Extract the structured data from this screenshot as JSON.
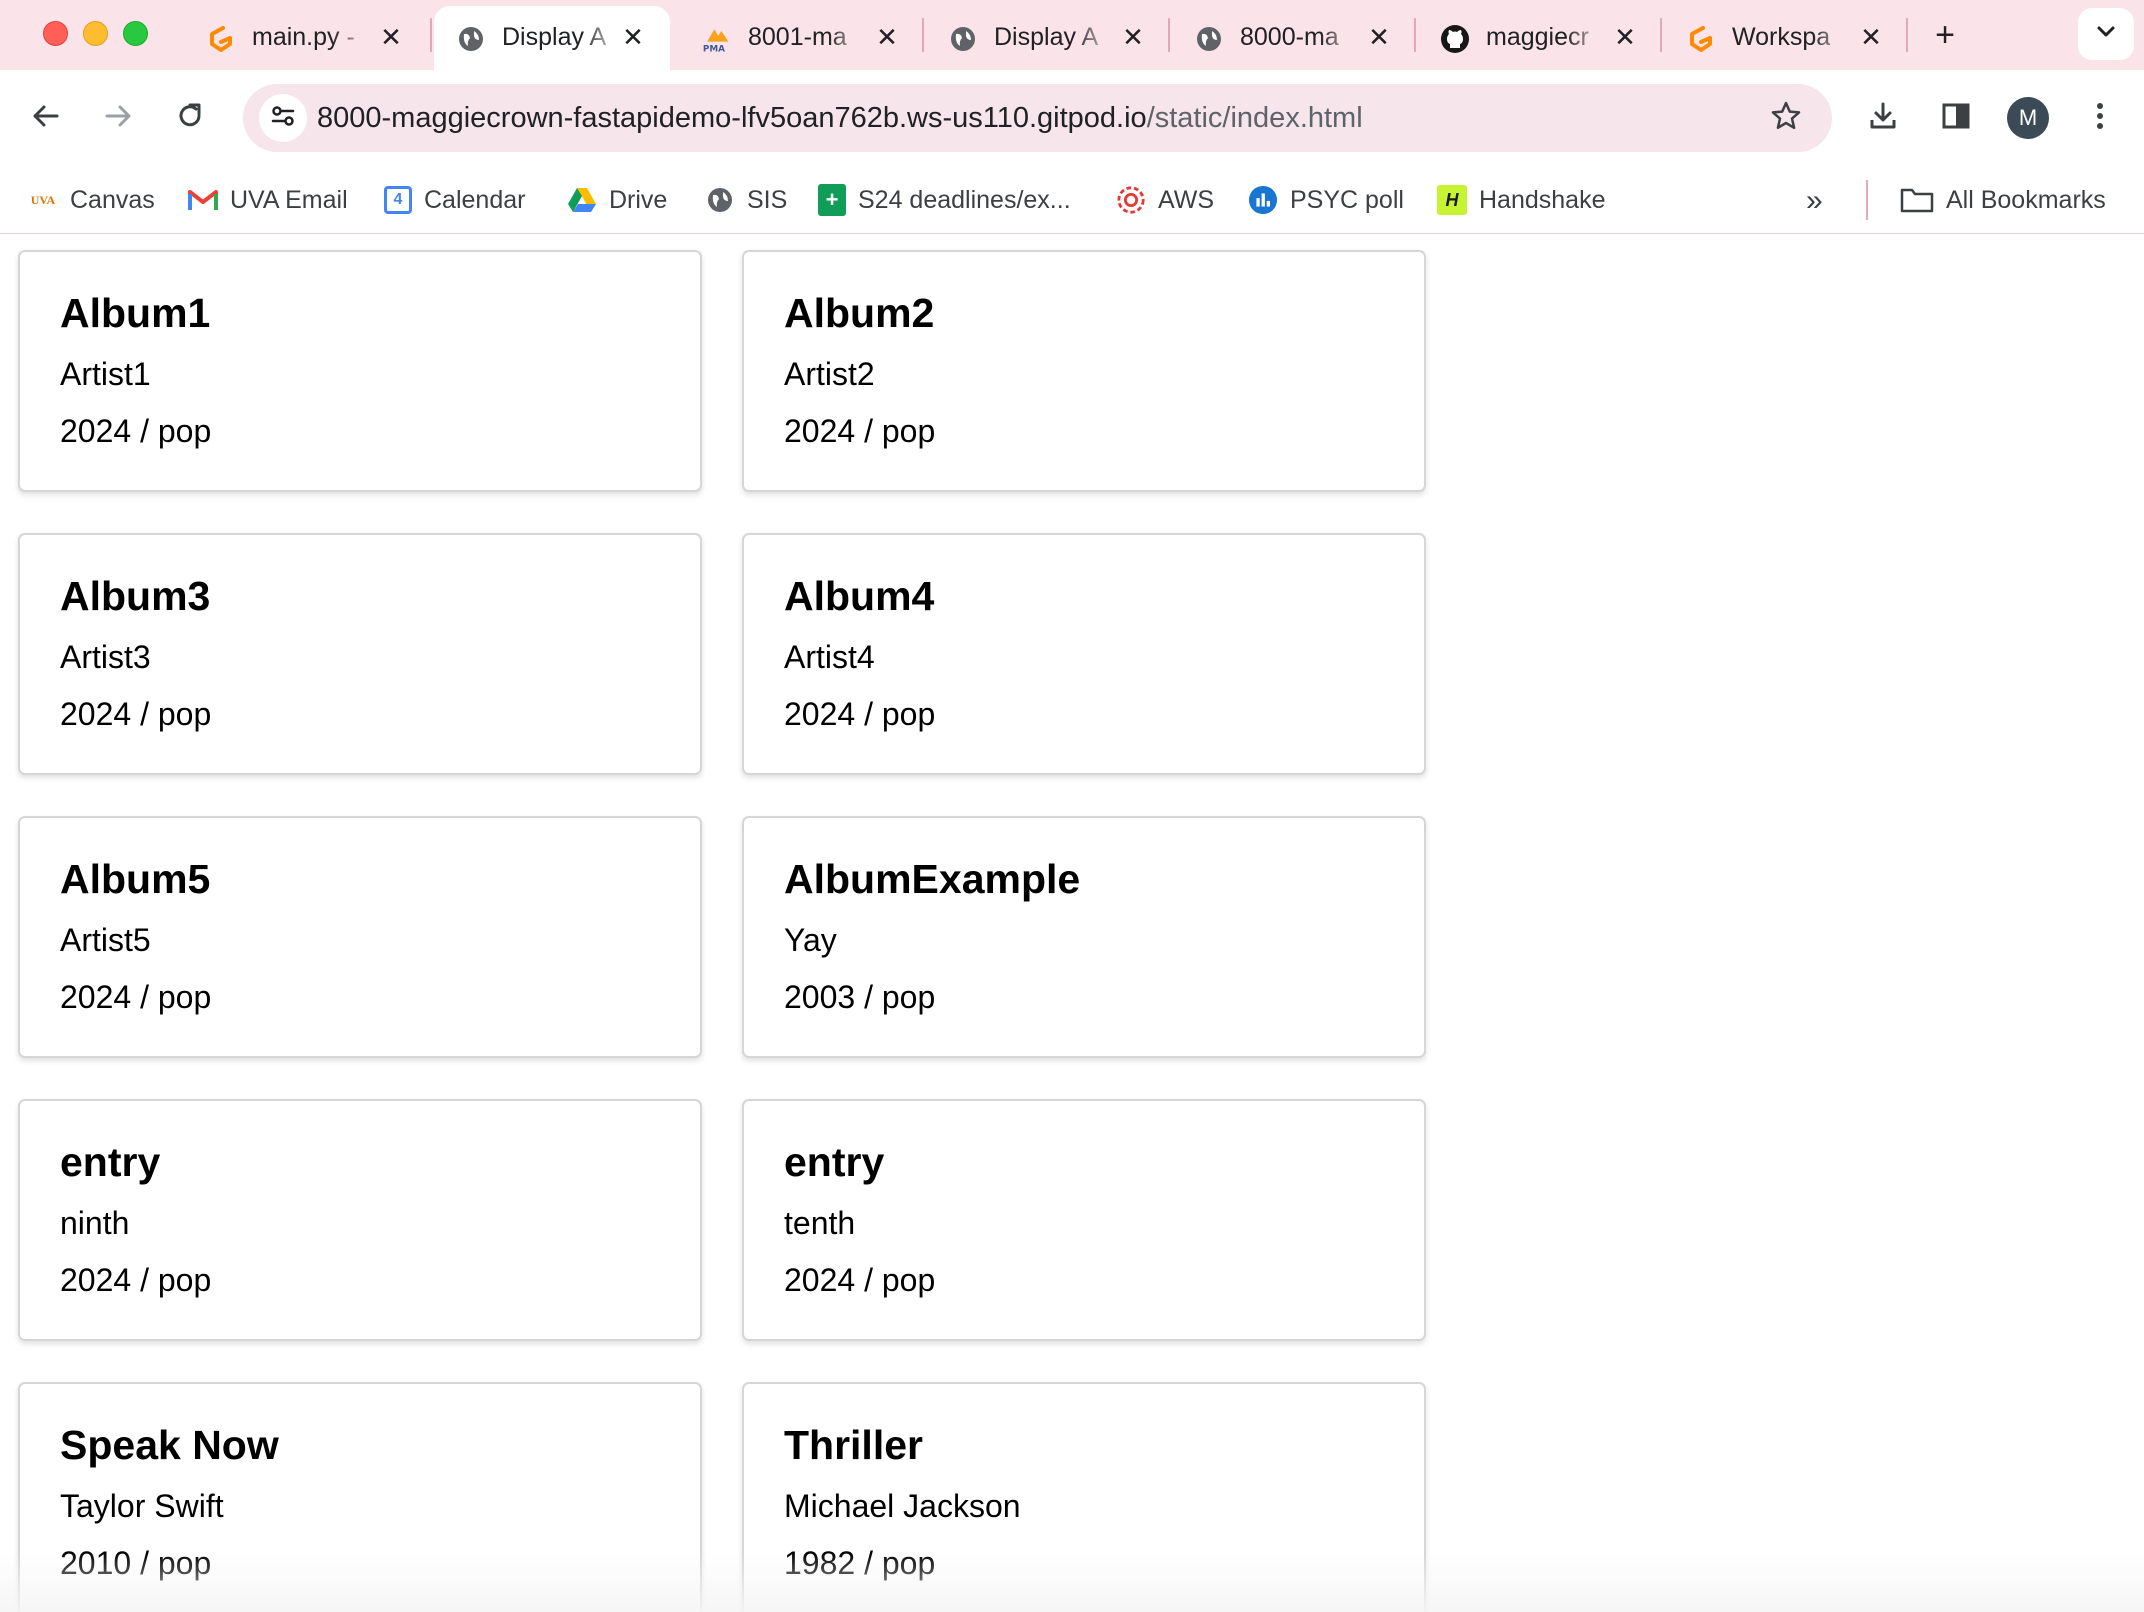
{
  "browser": {
    "tabs": [
      {
        "title": "main.py - ",
        "icon": "gitpod-icon",
        "active": false
      },
      {
        "title": "Display A",
        "icon": "globe-icon",
        "active": true
      },
      {
        "title": "8001-ma",
        "icon": "phpmyadmin-icon",
        "icon_text": "PMA",
        "active": false
      },
      {
        "title": "Display A",
        "icon": "globe-icon",
        "active": false
      },
      {
        "title": "8000-ma",
        "icon": "globe-icon",
        "active": false
      },
      {
        "title": "maggiecr",
        "icon": "github-icon",
        "active": false
      },
      {
        "title": "Workspa",
        "icon": "gitpod-icon",
        "active": false
      }
    ],
    "new_tab_symbol": "+",
    "close_symbol": "✕",
    "url_host": "8000-maggiecrown-fastapidemo-lfv5oan762b.ws-us110.gitpod.io",
    "url_path": "/static/index.html",
    "profile_initial": "M",
    "bookmarks": [
      {
        "label": "Canvas",
        "icon": "uva-icon",
        "icon_text": "UVA",
        "color": "#e57200"
      },
      {
        "label": "UVA Email",
        "icon": "gmail-icon",
        "icon_text": "M",
        "color": "#ea4335"
      },
      {
        "label": "Calendar",
        "icon": "calendar-icon",
        "icon_text": "4",
        "color": "#4285f4"
      },
      {
        "label": "Drive",
        "icon": "drive-icon",
        "color": "#fbbc04"
      },
      {
        "label": "SIS",
        "icon": "globe-icon",
        "color": "#5f6368"
      },
      {
        "label": "S24 deadlines/ex...",
        "icon": "sheets-icon",
        "icon_text": "+",
        "color": "#0f9d58"
      },
      {
        "label": "AWS",
        "icon": "aws-icon",
        "color": "#e53935"
      },
      {
        "label": "PSYC poll",
        "icon": "poll-icon",
        "color": "#1976d2"
      },
      {
        "label": "Handshake",
        "icon": "handshake-icon",
        "icon_text": "H",
        "color": "#c6f432"
      }
    ],
    "overflow_symbol": "»",
    "all_bookmarks_label": "All Bookmarks"
  },
  "albums": [
    {
      "title": "Album1",
      "artist": "Artist1",
      "meta": "2024 / pop"
    },
    {
      "title": "Album2",
      "artist": "Artist2",
      "meta": "2024 / pop"
    },
    {
      "title": "Album3",
      "artist": "Artist3",
      "meta": "2024 / pop"
    },
    {
      "title": "Album4",
      "artist": "Artist4",
      "meta": "2024 / pop"
    },
    {
      "title": "Album5",
      "artist": "Artist5",
      "meta": "2024 / pop"
    },
    {
      "title": "AlbumExample",
      "artist": "Yay",
      "meta": "2003 / pop"
    },
    {
      "title": "entry",
      "artist": "ninth",
      "meta": "2024 / pop"
    },
    {
      "title": "entry",
      "artist": "tenth",
      "meta": "2024 / pop"
    },
    {
      "title": "Speak Now",
      "artist": "Taylor Swift",
      "meta": "2010 / pop"
    },
    {
      "title": "Thriller",
      "artist": "Michael Jackson",
      "meta": "1982 / pop"
    }
  ]
}
